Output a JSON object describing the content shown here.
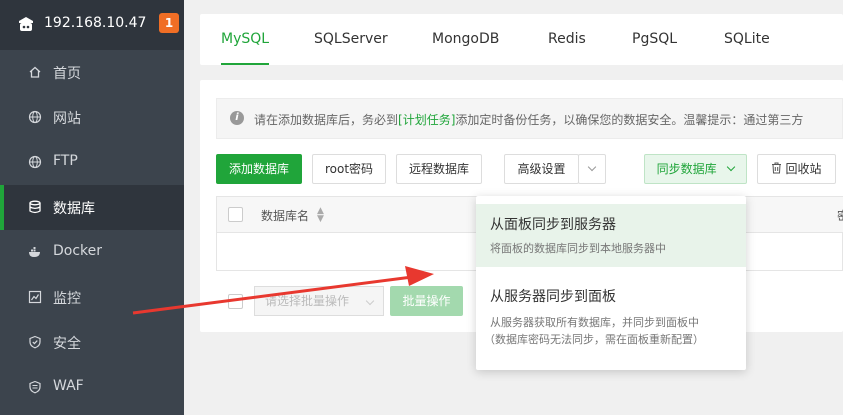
{
  "sidebar": {
    "ip": "192.168.10.47",
    "badge": "1",
    "items": [
      {
        "label": "首页",
        "icon": "home-icon"
      },
      {
        "label": "网站",
        "icon": "globe-icon"
      },
      {
        "label": "FTP",
        "icon": "globe-icon"
      },
      {
        "label": "数据库",
        "icon": "database-icon",
        "active": true
      },
      {
        "label": "Docker",
        "icon": "docker-icon"
      },
      {
        "label": "监控",
        "icon": "monitor-icon"
      },
      {
        "label": "安全",
        "icon": "shield-icon"
      },
      {
        "label": "WAF",
        "icon": "waf-shield-icon"
      }
    ]
  },
  "tabs": [
    "MySQL",
    "SQLServer",
    "MongoDB",
    "Redis",
    "PgSQL",
    "SQLite"
  ],
  "active_tab": "MySQL",
  "notice": {
    "before": "请在添加数据库后，务必到",
    "link": "[计划任务]",
    "after": "添加定时备份任务，以确保您的数据安全。温馨提示：通过第三方"
  },
  "toolbar": {
    "add_db": "添加数据库",
    "root_pwd": "root密码",
    "remote_db": "远程数据库",
    "advanced": "高级设置",
    "sync_db": "同步数据库",
    "recycle": "回收站"
  },
  "table": {
    "col_name": "数据库名",
    "col_right": "密"
  },
  "batch": {
    "placeholder": "请选择批量操作",
    "button": "批量操作"
  },
  "dropdown": {
    "items": [
      {
        "title": "从面板同步到服务器",
        "desc": "将面板的数据库同步到本地服务器中"
      },
      {
        "title": "从服务器同步到面板",
        "desc": "从服务器获取所有数据库，并同步到面板中",
        "desc2": "（数据库密码无法同步，需在面板重新配置）"
      }
    ]
  },
  "colors": {
    "accent": "#20a53a",
    "sidebar_bg": "#3c444d",
    "badge": "#f06e25",
    "arrow": "#e8382f"
  }
}
